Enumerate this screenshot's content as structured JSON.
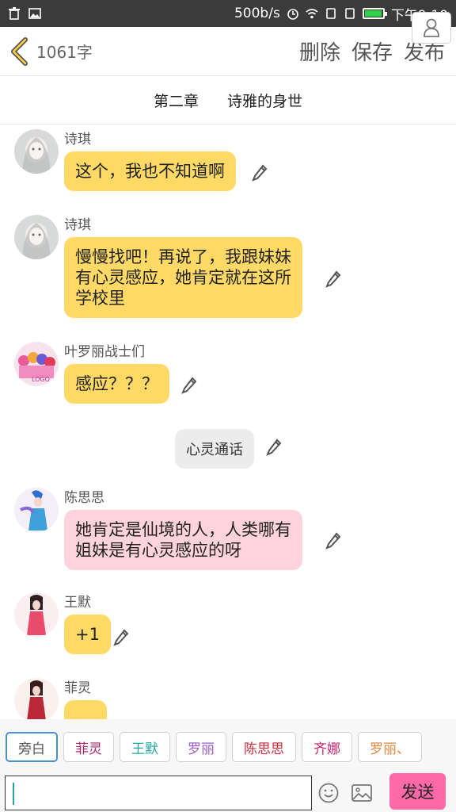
{
  "status_bar": {
    "net_speed": "500b/s",
    "time": "下午9:10"
  },
  "header": {
    "word_count": "1061字",
    "delete": "删除",
    "save": "保存",
    "publish": "发布"
  },
  "chapter": {
    "number": "第二章",
    "title": "诗雅的身世"
  },
  "messages": [
    {
      "name": "诗琪",
      "text": "这个，我也不知道啊",
      "color": "#ffd966"
    },
    {
      "name": "诗琪",
      "lines": [
        "慢慢找吧！再说了，我跟妹妹",
        "有心灵感应，她肯定就在这所",
        "学校里"
      ],
      "color": "#ffd966"
    },
    {
      "name": "叶罗丽战士们",
      "text": "感应？？？",
      "color": "#ffd966"
    },
    {
      "name": "陈思思",
      "lines": [
        "她肯定是仙境的人，人类哪有",
        "姐妹是有心灵感应的呀"
      ],
      "color": "#ffd3de"
    },
    {
      "name": "王默",
      "text": "+1",
      "color": "#ffd966"
    },
    {
      "name": "菲灵",
      "text": "",
      "color": "#ffd966"
    }
  ],
  "narration": {
    "text": "心灵通话"
  },
  "roles": [
    {
      "label": "旁白",
      "color": "#555555"
    },
    {
      "label": "菲灵",
      "color": "#b0246e"
    },
    {
      "label": "王默",
      "color": "#25a6a0"
    },
    {
      "label": "罗丽",
      "color": "#a05cc8"
    },
    {
      "label": "陈思思",
      "color": "#c8303a"
    },
    {
      "label": "齐娜",
      "color": "#c8246e"
    },
    {
      "label": "罗丽、",
      "color": "#e08a40"
    }
  ],
  "input": {
    "send": "发送"
  },
  "icons": [
    "back-icon",
    "edit-icon",
    "user-icon",
    "emoji-icon",
    "image-icon",
    "trash-icon",
    "gallery-icon",
    "alarm-icon",
    "wifi-icon",
    "battery-icon"
  ]
}
